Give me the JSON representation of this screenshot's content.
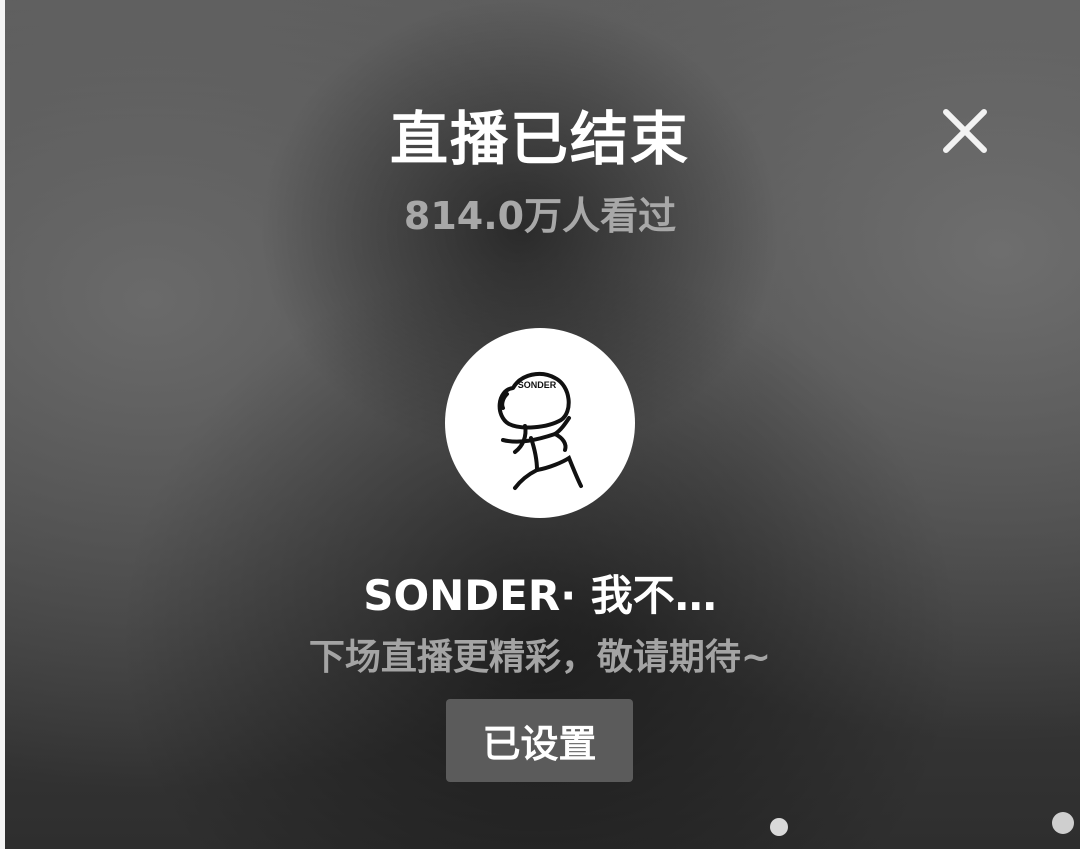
{
  "header": {
    "title": "直播已结束",
    "viewers_text": "814.0万人看过",
    "close_icon": "close-icon"
  },
  "streamer": {
    "avatar_text": "SONDER",
    "name": "SONDER· 我不…"
  },
  "next_live": {
    "message": "下场直播更精彩，敬请期待~",
    "button_label": "已设置"
  },
  "colors": {
    "title": "#ffffff",
    "muted_text": "#a8a8a8",
    "button_bg": "#5b5b5b",
    "avatar_bg": "#ffffff"
  }
}
